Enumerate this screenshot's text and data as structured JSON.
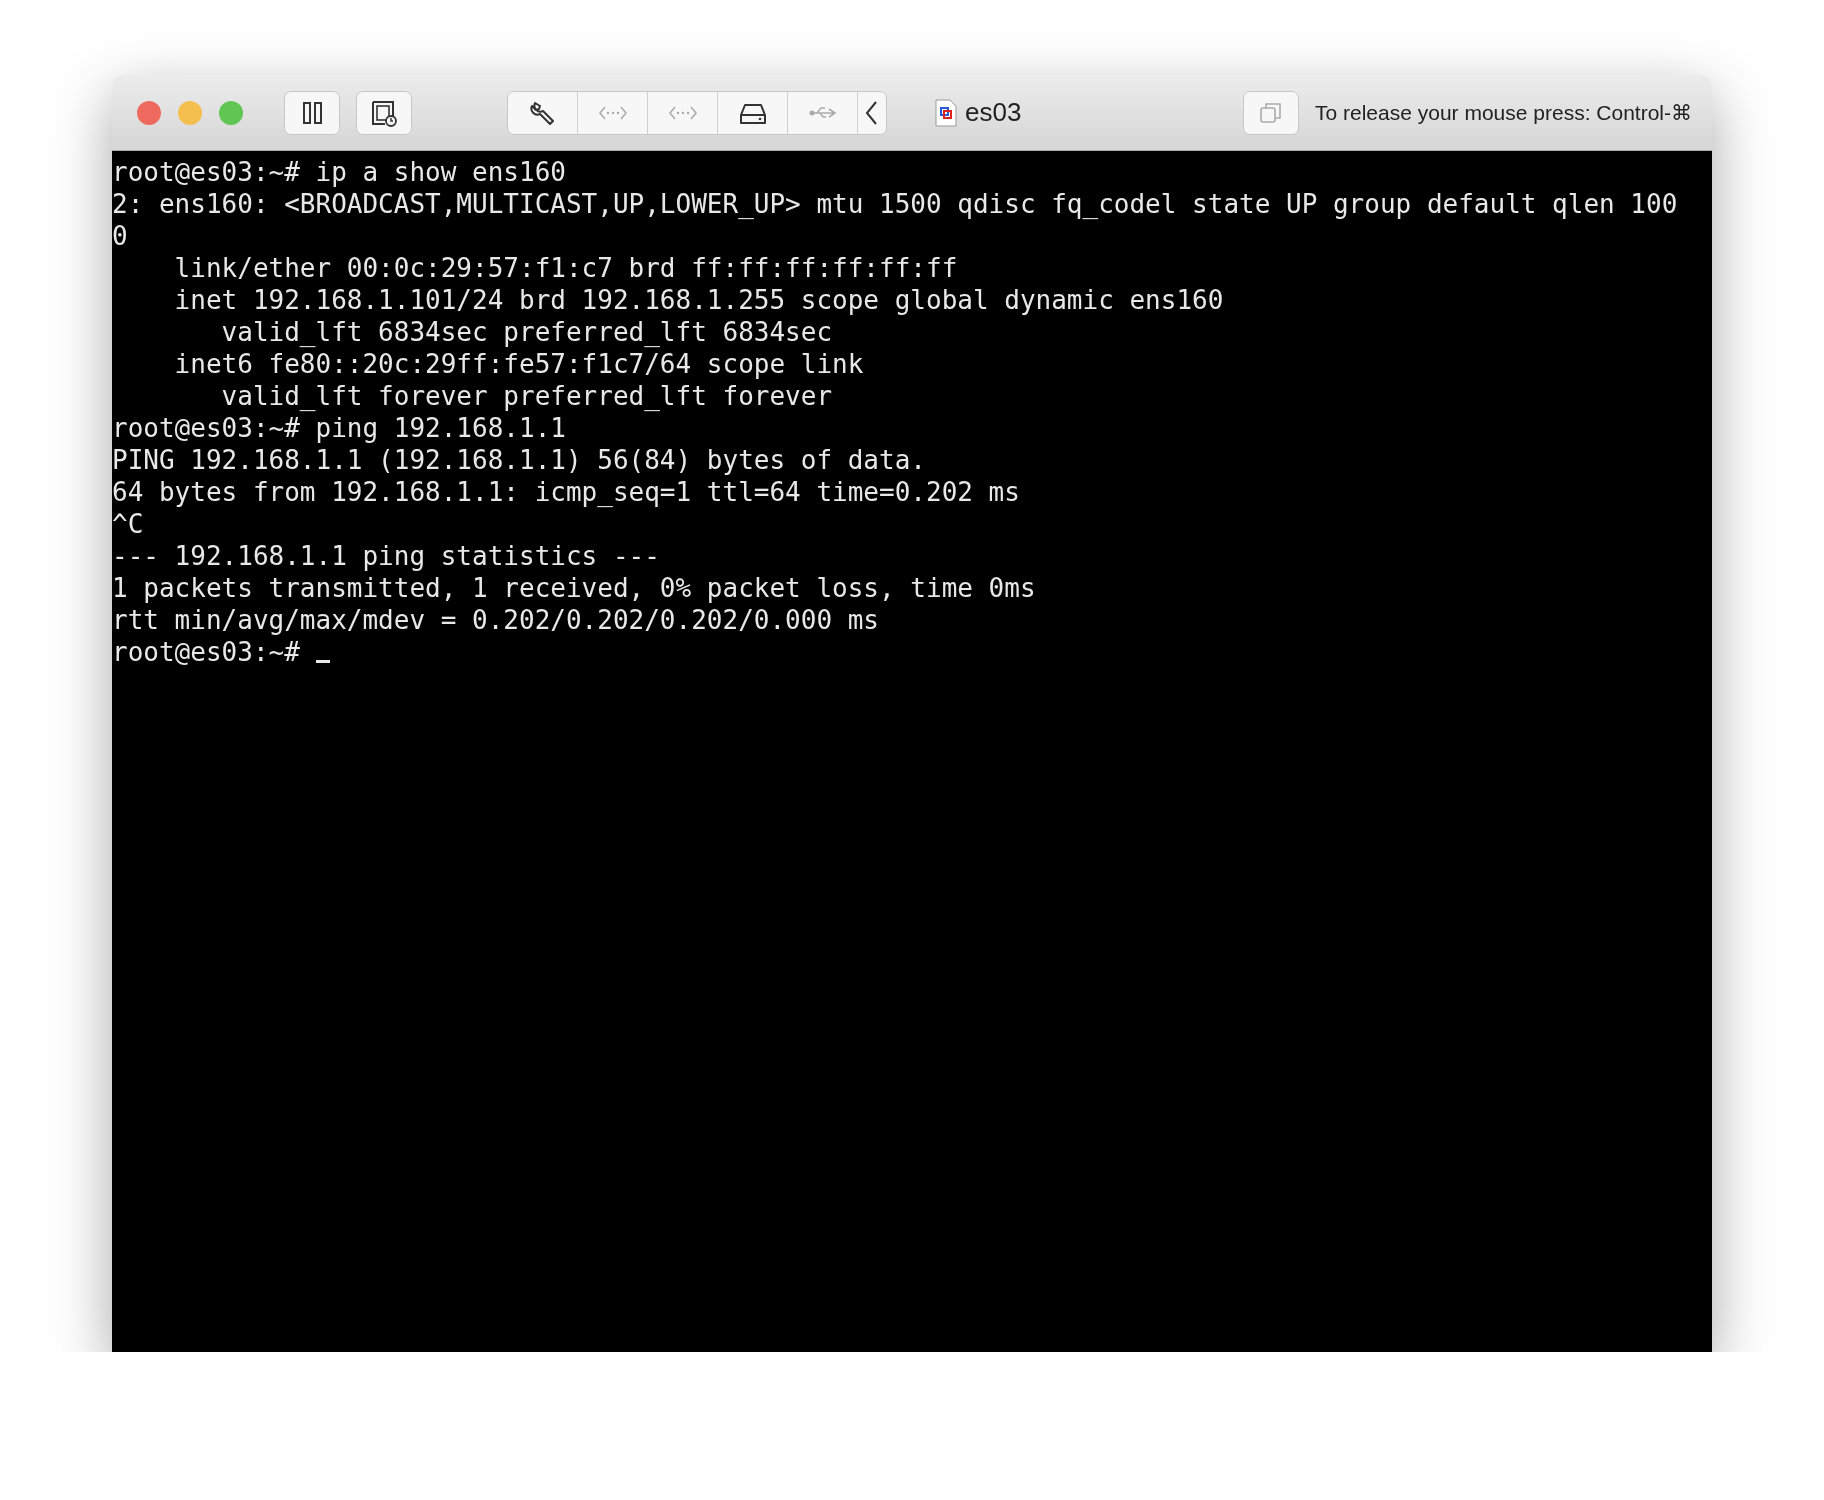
{
  "window": {
    "title": "es03",
    "traffic_lights": [
      {
        "color": "#ee6a5f"
      },
      {
        "color": "#f5bf4f"
      },
      {
        "color": "#61c554"
      }
    ]
  },
  "toolbar": {
    "left_buttons": [
      {
        "kind": "pause",
        "disabled": false
      },
      {
        "kind": "snapshot",
        "disabled": false
      }
    ],
    "segments": [
      {
        "kind": "settings",
        "disabled": false
      },
      {
        "kind": "network",
        "disabled": true
      },
      {
        "kind": "network",
        "disabled": true
      },
      {
        "kind": "disk",
        "disabled": false
      },
      {
        "kind": "usb",
        "disabled": true
      },
      {
        "kind": "chevron",
        "disabled": false
      }
    ],
    "right_button": {
      "kind": "copy",
      "disabled": true
    },
    "message": "To release your mouse press: Control-⌘"
  },
  "terminal": {
    "lines": [
      "root@es03:~# ip a show ens160",
      "2: ens160: <BROADCAST,MULTICAST,UP,LOWER_UP> mtu 1500 qdisc fq_codel state UP group default qlen 100",
      "0",
      "    link/ether 00:0c:29:57:f1:c7 brd ff:ff:ff:ff:ff:ff",
      "    inet 192.168.1.101/24 brd 192.168.1.255 scope global dynamic ens160",
      "       valid_lft 6834sec preferred_lft 6834sec",
      "    inet6 fe80::20c:29ff:fe57:f1c7/64 scope link",
      "       valid_lft forever preferred_lft forever",
      "root@es03:~# ping 192.168.1.1",
      "PING 192.168.1.1 (192.168.1.1) 56(84) bytes of data.",
      "64 bytes from 192.168.1.1: icmp_seq=1 ttl=64 time=0.202 ms",
      "^C",
      "--- 192.168.1.1 ping statistics ---",
      "1 packets transmitted, 1 received, 0% packet loss, time 0ms",
      "rtt min/avg/max/mdev = 0.202/0.202/0.202/0.000 ms",
      "root@es03:~# "
    ],
    "cursor_visible": true
  }
}
